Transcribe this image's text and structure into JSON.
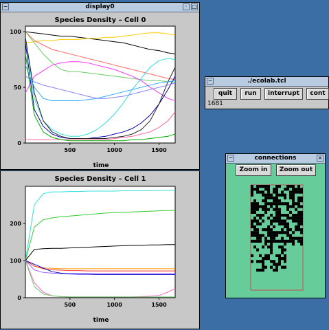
{
  "windows": {
    "display0": {
      "title": "display0",
      "chart_title": "Species Density – Cell 0",
      "xlabel": "time",
      "ytick_labels": [
        "0",
        "50",
        "100"
      ],
      "xtick_labels": [
        "500",
        "1000",
        "1500"
      ]
    },
    "display1": {
      "chart_title": "Species Density – Cell 1",
      "xlabel": "time",
      "ytick_labels": [
        "0",
        "100",
        "200"
      ],
      "xtick_labels": [
        "500",
        "1000",
        "1500"
      ]
    },
    "ecolab": {
      "title": "./ecolab.tcl",
      "buttons": [
        "quit",
        "run",
        "interrupt",
        "cont"
      ],
      "status": "1681"
    },
    "connections": {
      "title": "connections",
      "zoom_in": "Zoom in",
      "zoom_out": "Zoom out"
    }
  },
  "colors": {
    "desktop": "#3a6ea5",
    "connections_bg": "#66cc99",
    "connections_frame": "#c05050"
  },
  "chart_data": [
    {
      "type": "line",
      "title": "Species Density – Cell 0",
      "xlabel": "time",
      "ylabel": "",
      "xlim": [
        0,
        1681
      ],
      "ylim": [
        0,
        105
      ],
      "x": [
        0,
        100,
        200,
        300,
        400,
        500,
        600,
        700,
        800,
        900,
        1000,
        1100,
        1200,
        1300,
        1400,
        1500,
        1600,
        1681
      ],
      "series": [
        {
          "color": "#000000",
          "values": [
            100,
            99,
            98,
            97,
            96,
            96,
            95,
            94,
            93,
            92,
            91,
            90,
            88,
            86,
            84,
            83,
            81,
            80
          ]
        },
        {
          "color": "#ffcc00",
          "values": [
            90,
            91,
            92,
            92,
            93,
            93,
            93,
            94,
            94,
            95,
            95,
            96,
            97,
            98,
            99,
            99,
            98,
            97
          ]
        },
        {
          "color": "#ff6666",
          "values": [
            100,
            92,
            88,
            84,
            82,
            80,
            78,
            76,
            74,
            72,
            70,
            68,
            66,
            64,
            62,
            60,
            58,
            57
          ]
        },
        {
          "color": "#66cc66",
          "values": [
            100,
            90,
            80,
            72,
            66,
            64,
            64,
            63,
            62,
            61,
            60,
            59,
            58,
            57,
            56,
            56,
            55,
            55
          ]
        },
        {
          "color": "#ff33ff",
          "values": [
            45,
            60,
            65,
            70,
            72,
            73,
            73,
            72,
            70,
            68,
            66,
            63,
            60,
            56,
            50,
            45,
            40,
            38
          ]
        },
        {
          "color": "#33dddd",
          "values": [
            95,
            40,
            20,
            12,
            8,
            6,
            6,
            8,
            12,
            18,
            26,
            36,
            48,
            58,
            68,
            74,
            76,
            75
          ]
        },
        {
          "color": "#0000aa",
          "values": [
            90,
            30,
            15,
            8,
            5,
            4,
            4,
            4,
            5,
            6,
            8,
            10,
            13,
            18,
            25,
            35,
            48,
            60
          ]
        },
        {
          "color": "#222222",
          "values": [
            95,
            45,
            20,
            10,
            6,
            4,
            4,
            4,
            4,
            4,
            5,
            6,
            8,
            12,
            20,
            35,
            55,
            68
          ]
        },
        {
          "color": "#8080ff",
          "values": [
            60,
            55,
            52,
            50,
            48,
            46,
            44,
            42,
            40,
            40,
            41,
            42,
            44,
            46,
            48,
            50,
            52,
            54
          ]
        },
        {
          "color": "#33aaff",
          "values": [
            70,
            50,
            40,
            38,
            38,
            38,
            38,
            39,
            40,
            42,
            44,
            46,
            48,
            50,
            52,
            54,
            55,
            56
          ]
        },
        {
          "color": "#ff6699",
          "values": [
            3,
            3,
            3,
            3,
            3,
            3,
            3,
            3,
            3,
            3,
            4,
            5,
            6,
            8,
            10,
            14,
            20,
            28
          ]
        },
        {
          "color": "#00aa00",
          "values": [
            80,
            25,
            10,
            5,
            3,
            2,
            2,
            2,
            2,
            2,
            2,
            2,
            3,
            3,
            4,
            5,
            6,
            8
          ]
        }
      ]
    },
    {
      "type": "line",
      "title": "Species Density – Cell 1",
      "xlabel": "time",
      "ylabel": "",
      "xlim": [
        0,
        1681
      ],
      "ylim": [
        0,
        300
      ],
      "x": [
        0,
        100,
        200,
        300,
        400,
        500,
        600,
        700,
        800,
        900,
        1000,
        1100,
        1200,
        1300,
        1400,
        1500,
        1600,
        1681
      ],
      "series": [
        {
          "color": "#33dddd",
          "values": [
            100,
            250,
            280,
            285,
            285,
            286,
            286,
            287,
            287,
            287,
            287,
            288,
            288,
            288,
            288,
            289,
            289,
            289
          ]
        },
        {
          "color": "#33cc33",
          "values": [
            100,
            190,
            210,
            215,
            218,
            220,
            222,
            224,
            226,
            228,
            229,
            230,
            231,
            232,
            233,
            234,
            235,
            235
          ]
        },
        {
          "color": "#000000",
          "values": [
            100,
            130,
            132,
            133,
            133,
            134,
            135,
            136,
            137,
            138,
            139,
            140,
            141,
            141,
            142,
            142,
            143,
            143
          ]
        },
        {
          "color": "#ff9900",
          "values": [
            100,
            85,
            80,
            79,
            78,
            78,
            78,
            78,
            78,
            78,
            78,
            78,
            78,
            78,
            78,
            78,
            78,
            78
          ]
        },
        {
          "color": "#ff3333",
          "values": [
            100,
            85,
            78,
            75,
            74,
            73,
            73,
            72,
            72,
            72,
            72,
            72,
            72,
            72,
            72,
            72,
            72,
            72
          ]
        },
        {
          "color": "#9966ff",
          "values": [
            100,
            75,
            68,
            66,
            65,
            65,
            65,
            65,
            65,
            65,
            65,
            65,
            65,
            65,
            65,
            65,
            65,
            65
          ]
        },
        {
          "color": "#0000cc",
          "values": [
            100,
            90,
            80,
            70,
            66,
            64,
            63,
            63,
            62,
            62,
            62,
            62,
            62,
            62,
            62,
            62,
            62,
            62
          ]
        },
        {
          "color": "#ff66cc",
          "values": [
            100,
            40,
            15,
            5,
            3,
            2,
            2,
            2,
            2,
            2,
            2,
            2,
            2,
            3,
            4,
            6,
            15,
            25
          ]
        },
        {
          "color": "#66cc66",
          "values": [
            100,
            30,
            10,
            5,
            3,
            2,
            2,
            2,
            2,
            2,
            2,
            2,
            2,
            2,
            2,
            2,
            2,
            2
          ]
        }
      ]
    }
  ]
}
